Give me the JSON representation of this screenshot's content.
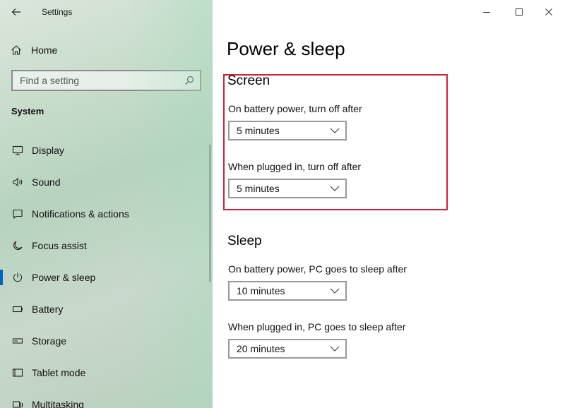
{
  "window": {
    "title": "Settings"
  },
  "sidebar": {
    "home_label": "Home",
    "search_placeholder": "Find a setting",
    "section_label": "System",
    "items": [
      {
        "label": "Display",
        "icon": "display-icon"
      },
      {
        "label": "Sound",
        "icon": "speaker-icon"
      },
      {
        "label": "Notifications & actions",
        "icon": "notification-icon"
      },
      {
        "label": "Focus assist",
        "icon": "moon-icon"
      },
      {
        "label": "Power & sleep",
        "icon": "power-icon",
        "active": true
      },
      {
        "label": "Battery",
        "icon": "battery-icon"
      },
      {
        "label": "Storage",
        "icon": "storage-icon"
      },
      {
        "label": "Tablet mode",
        "icon": "tablet-icon"
      },
      {
        "label": "Multitasking",
        "icon": "multitasking-icon"
      }
    ]
  },
  "main": {
    "page_title": "Power & sleep",
    "screen": {
      "title": "Screen",
      "battery_label": "On battery power, turn off after",
      "battery_value": "5 minutes",
      "plugged_label": "When plugged in, turn off after",
      "plugged_value": "5 minutes"
    },
    "sleep": {
      "title": "Sleep",
      "battery_label": "On battery power, PC goes to sleep after",
      "battery_value": "10 minutes",
      "plugged_label": "When plugged in, PC goes to sleep after",
      "plugged_value": "20 minutes"
    }
  },
  "colors": {
    "accent": "#0067c0",
    "highlight_box": "#c8243a"
  }
}
